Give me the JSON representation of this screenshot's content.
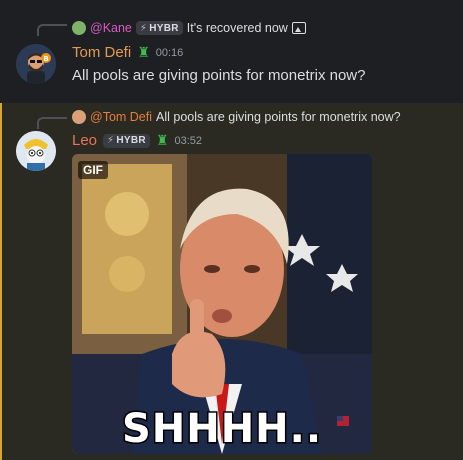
{
  "messages": [
    {
      "reply": {
        "author": "@Kane",
        "tag": "HYBR",
        "text": "It's recovered now"
      },
      "author": "Tom Defi",
      "timestamp": "00:16",
      "content": "All pools are giving points for monetrix now?",
      "author_color": "#e59a52"
    },
    {
      "reply": {
        "author": "@Tom Defi",
        "text": "All pools are giving points for monetrix now?"
      },
      "author": "Leo",
      "tag": "HYBR",
      "timestamp": "03:52",
      "author_color": "#e8745a",
      "gif": {
        "badge": "GIF",
        "caption": "SHHHH.."
      }
    }
  ]
}
